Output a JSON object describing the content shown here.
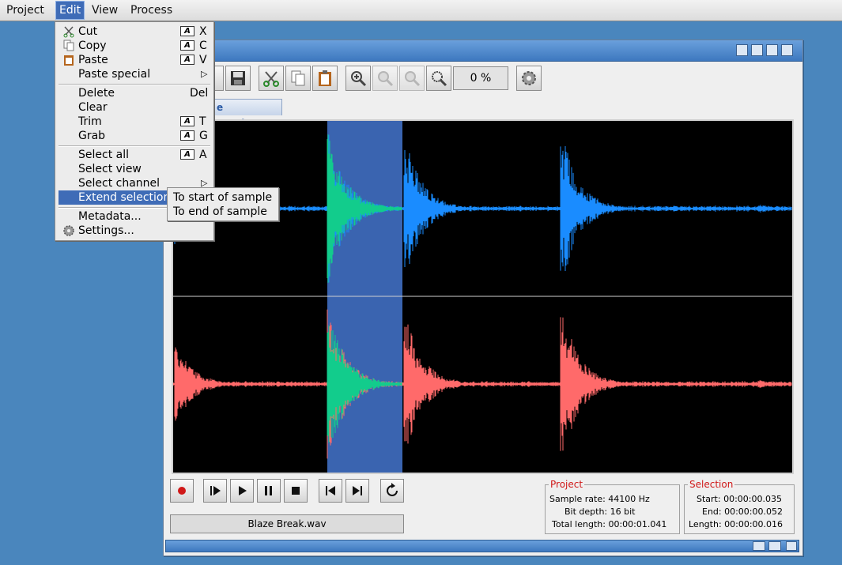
{
  "menubar": {
    "items": [
      {
        "label": "Project"
      },
      {
        "label": "Edit"
      },
      {
        "label": "View"
      },
      {
        "label": "Process"
      }
    ]
  },
  "window": {
    "title_fragment": "e",
    "zoom_value": "0 %",
    "tab_label": "e Break.wav",
    "filename": "Blaze Break.wav"
  },
  "project_info": {
    "legend": "Project",
    "sample_rate": "Sample rate: 44100 Hz",
    "bit_depth": "Bit depth: 16 bit",
    "total_length": "Total length: 00:00:01.041"
  },
  "selection_info": {
    "legend": "Selection",
    "start": "Start: 00:00:00.035",
    "end": "End: 00:00:00.052",
    "length": "Length: 00:00:00.016"
  },
  "edit_menu": {
    "items": [
      {
        "label": "Cut",
        "key": "X"
      },
      {
        "label": "Copy",
        "key": "C"
      },
      {
        "label": "Paste",
        "key": "V"
      },
      {
        "label": "Paste special"
      },
      {
        "label": "Delete",
        "shortcut": "Del"
      },
      {
        "label": "Clear"
      },
      {
        "label": "Trim",
        "key": "T"
      },
      {
        "label": "Grab",
        "key": "G"
      },
      {
        "label": "Select all",
        "key": "A"
      },
      {
        "label": "Select view"
      },
      {
        "label": "Select channel"
      },
      {
        "label": "Extend selection"
      },
      {
        "label": "Metadata..."
      },
      {
        "label": "Settings..."
      }
    ],
    "amiga_key_glyph": "A"
  },
  "extend_submenu": {
    "items": [
      {
        "label": "To start of sample"
      },
      {
        "label": "To end of sample"
      }
    ]
  },
  "colors": {
    "desktop": "#4a86bd",
    "highlight": "#3f6cb7",
    "wave_left": "#1a8cff",
    "wave_right": "#ff6a6a",
    "wave_selected": "#12cc8c",
    "selection_bg": "#3a64b0"
  }
}
